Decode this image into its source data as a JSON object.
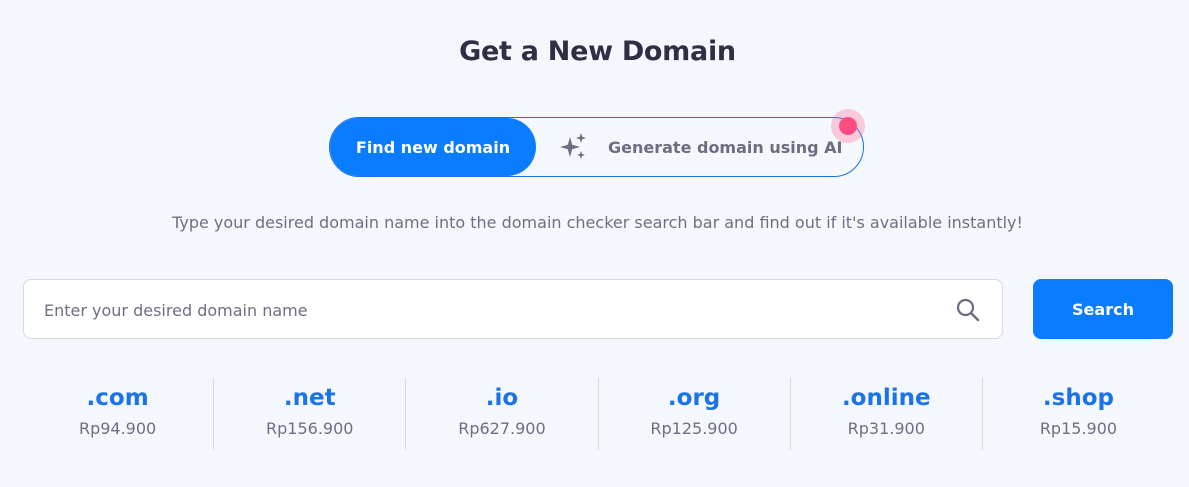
{
  "page": {
    "title": "Get a New Domain",
    "subtitle": "Type your desired domain name into the domain checker search bar and find out if it's available instantly!"
  },
  "toggle": {
    "active_label": "Find new domain",
    "ai_label": "Generate domain using AI",
    "ai_icon": "sparkle-icon"
  },
  "search": {
    "placeholder": "Enter your desired domain name",
    "value": "",
    "icon": "search-icon",
    "button_label": "Search"
  },
  "tlds": [
    {
      "name": ".com",
      "price": "Rp94.900"
    },
    {
      "name": ".net",
      "price": "Rp156.900"
    },
    {
      "name": ".io",
      "price": "Rp627.900"
    },
    {
      "name": ".org",
      "price": "Rp125.900"
    },
    {
      "name": ".online",
      "price": "Rp31.900"
    },
    {
      "name": ".shop",
      "price": "Rp15.900"
    }
  ],
  "colors": {
    "accent": "#0a7cff",
    "tld_text": "#1a73e8",
    "notification_dot": "#fc4d82",
    "background": "#f4f8fc"
  }
}
